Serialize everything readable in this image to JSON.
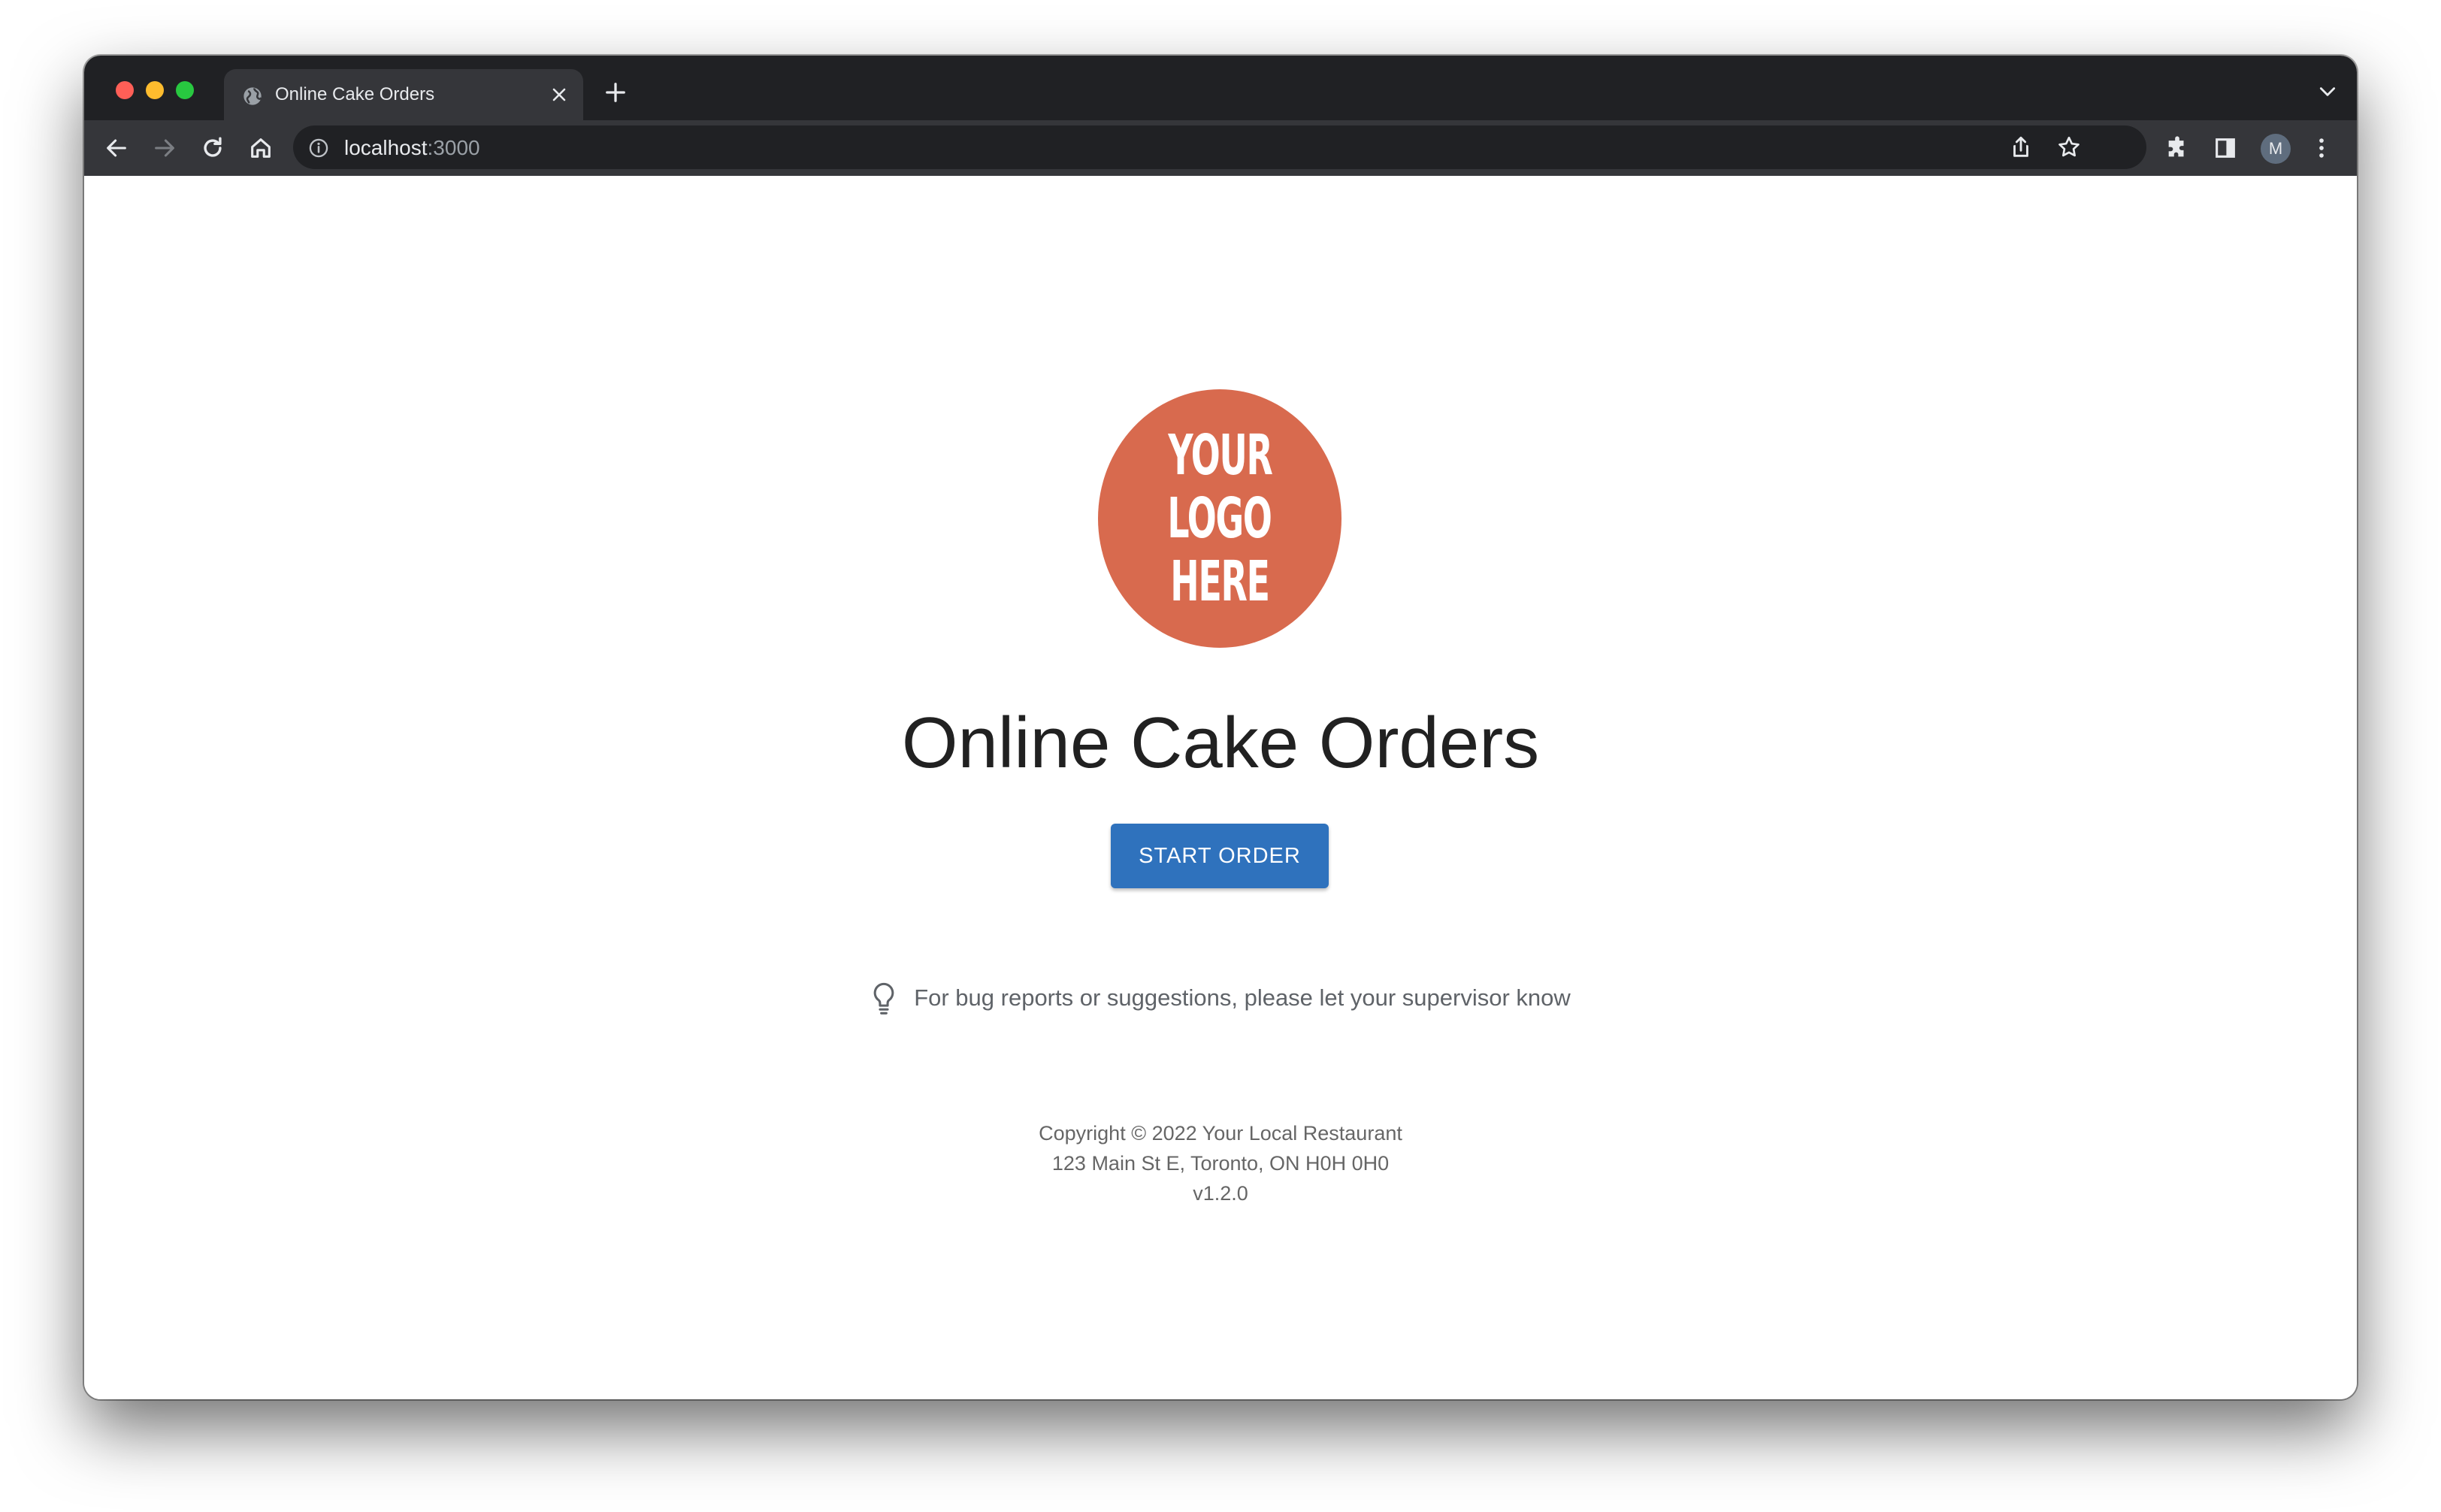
{
  "browser": {
    "tab": {
      "title": "Online Cake Orders"
    },
    "address": {
      "host": "localhost",
      "port": ":3000"
    },
    "profile_initial": "M"
  },
  "page": {
    "logo": {
      "lines": [
        "YOUR",
        "LOGO",
        "HERE"
      ],
      "color": "#d86a4e"
    },
    "title": "Online Cake Orders",
    "start_button_label": "START ORDER",
    "accent_color": "#2f72bd",
    "hint_text": "For bug reports or suggestions, please let your supervisor know",
    "footer": {
      "copyright": "Copyright © 2022 Your Local Restaurant",
      "address": "123 Main St E, Toronto, ON H0H 0H0",
      "version": "v1.2.0"
    }
  },
  "icons": [
    "globe-icon",
    "close-icon",
    "plus-icon",
    "chevron-down-icon",
    "back-icon",
    "forward-icon",
    "reload-icon",
    "home-icon",
    "info-icon",
    "share-icon",
    "star-icon",
    "extensions-icon",
    "side-panel-icon",
    "more-vert-icon",
    "lightbulb-icon"
  ]
}
